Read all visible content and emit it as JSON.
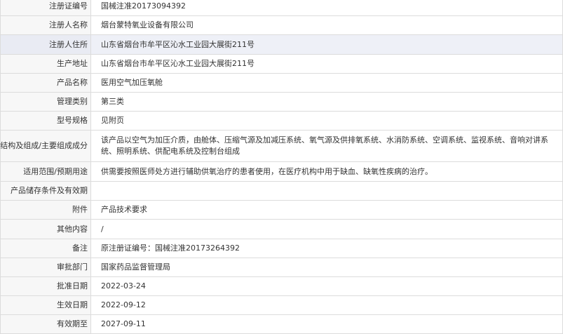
{
  "rows": [
    {
      "label": "注册证编号",
      "value": "国械注准20173094392"
    },
    {
      "label": "注册人名称",
      "value": "烟台蒙特氧业设备有限公司"
    },
    {
      "label": "注册人住所",
      "value": "山东省烟台市牟平区沁水工业园大展街211号"
    },
    {
      "label": "生产地址",
      "value": "山东省烟台市牟平区沁水工业园大展街211号"
    },
    {
      "label": "产品名称",
      "value": "医用空气加压氧舱"
    },
    {
      "label": "管理类别",
      "value": "第三类"
    },
    {
      "label": "型号规格",
      "value": "见附页"
    },
    {
      "label": "结构及组成/主要组成成分",
      "value": "该产品以空气为加压介质，由舱体、压缩气源及加减压系统、氧气源及供排氧系统、水消防系统、空调系统、监视系统、音响对讲系统、照明系统、供配电系统及控制台组成"
    },
    {
      "label": "适用范围/预期用途",
      "value": "供需要按照医师处方进行辅助供氧治疗的患者使用，在医疗机构中用于缺血、缺氧性疾病的治疗。"
    },
    {
      "label": "产品储存条件及有效期",
      "value": ""
    },
    {
      "label": "附件",
      "value": "产品技术要求"
    },
    {
      "label": "其他内容",
      "value": "/"
    },
    {
      "label": "备注",
      "value": "原注册证编号：国械注准20173264392"
    },
    {
      "label": "审批部门",
      "value": "国家药品监督管理局"
    },
    {
      "label": "批准日期",
      "value": "2022-03-24"
    },
    {
      "label": "生效日期",
      "value": "2022-09-12"
    },
    {
      "label": "有效期至",
      "value": "2027-09-11"
    }
  ]
}
